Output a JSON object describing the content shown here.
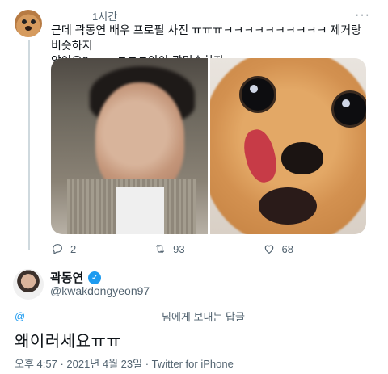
{
  "tweet": {
    "avatar": "dog-avatar",
    "time": "1시간",
    "text_line1": "근데 곽동연 배우 프로필 사진 ㅠㅠㅠㅋㅋㅋㅋㅋㅋㅋㅋㅋㅋ 제거랑 비슷하지",
    "text_line2": "않아요? ........ㅋㅋㅋ아아 곽민수하자",
    "stats": {
      "replies": "2",
      "retweets": "93",
      "likes": "68"
    }
  },
  "reply": {
    "display_name": "곽동연",
    "handle": "@kwakdongyeon97",
    "replying_mention": "@",
    "replying_label": "님에게 보내는 답글",
    "text": "왜이러세요ㅠㅠ",
    "footer": "오후 4:57 · 2021년 4월 23일 · Twitter for iPhone"
  },
  "colors": {
    "accent": "#1d9bf0",
    "muted": "#536471",
    "text": "#0f1419"
  },
  "icons": [
    "more-icon",
    "reply-icon",
    "retweet-icon",
    "like-icon",
    "verified-icon"
  ]
}
